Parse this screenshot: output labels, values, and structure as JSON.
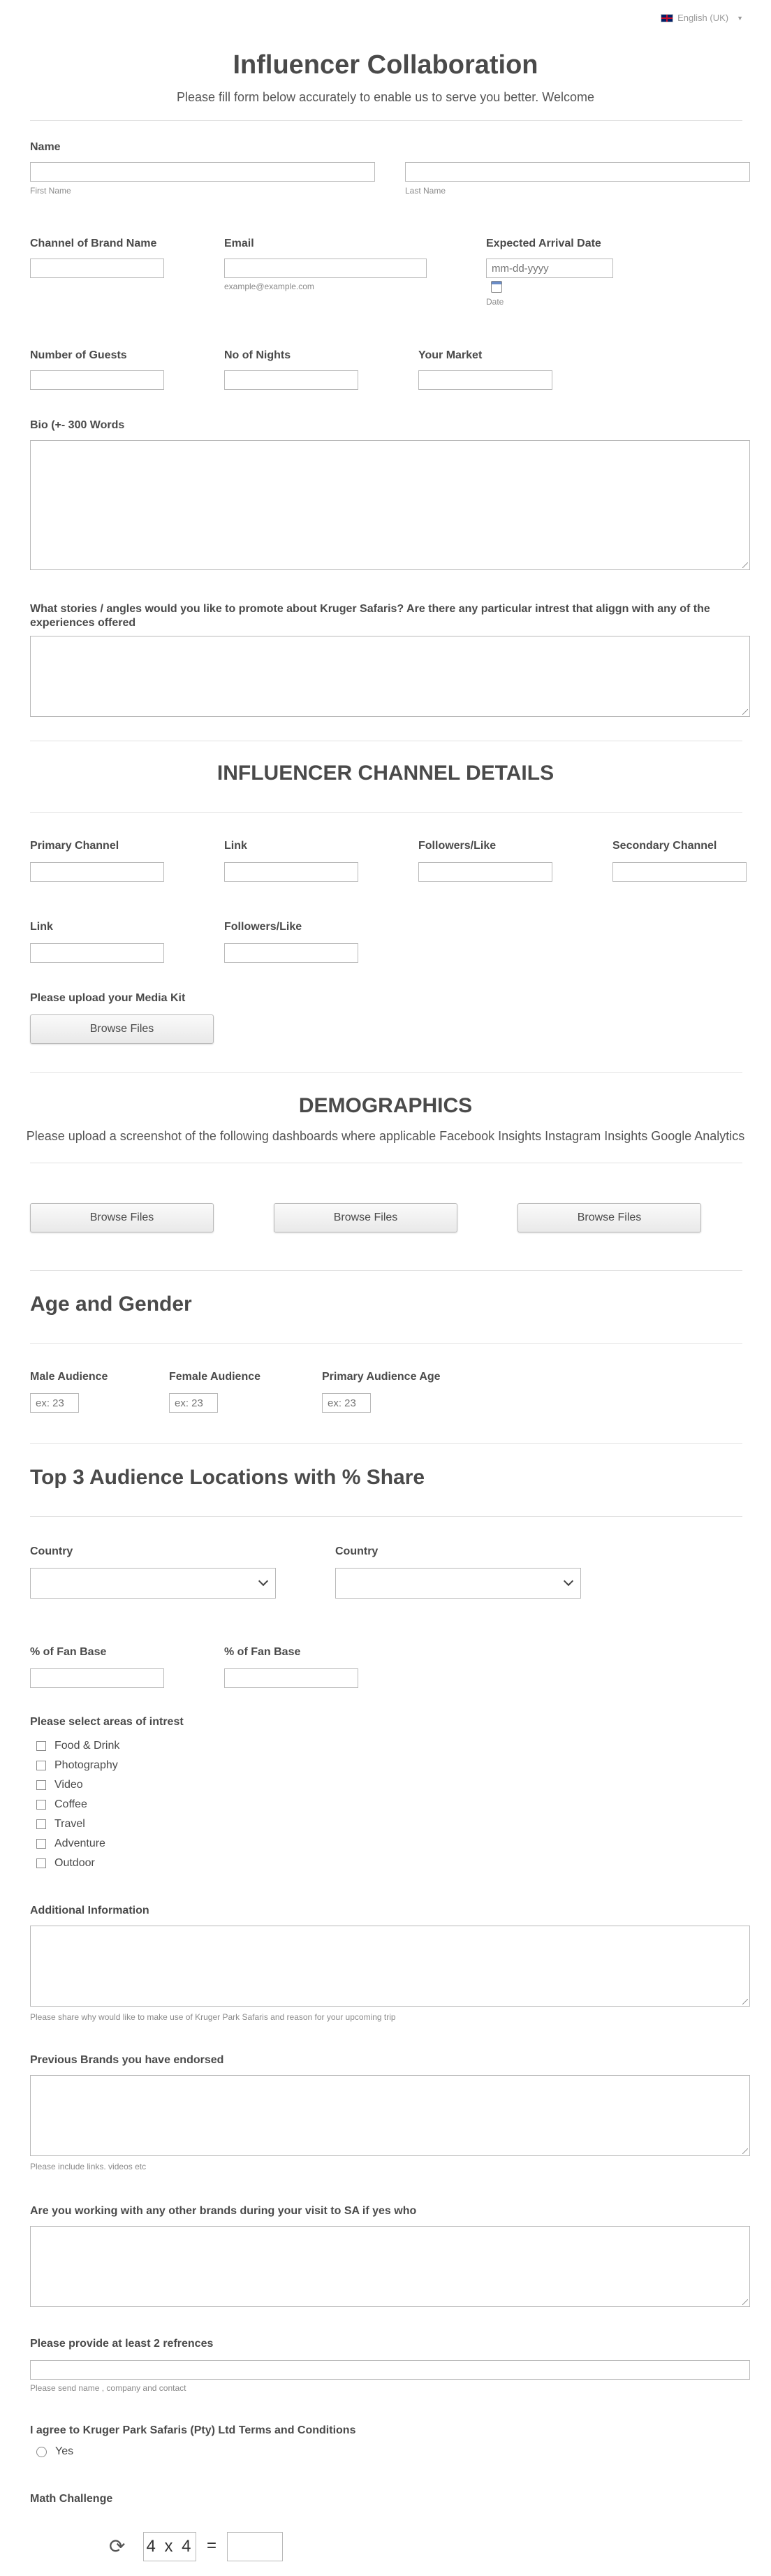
{
  "language": {
    "label": "English (UK)"
  },
  "header": {
    "title": "Influencer Collaboration",
    "subtitle": "Please fill form below accurately to enable us to serve you better. Welcome"
  },
  "fields": {
    "name_label": "Name",
    "first_name_sub": "First Name",
    "last_name_sub": "Last Name",
    "channel_label": "Channel of Brand Name",
    "email_label": "Email",
    "email_sub": "example@example.com",
    "arrival_label": "Expected Arrival Date",
    "arrival_placeholder": "mm-dd-yyyy",
    "arrival_sub": "Date",
    "guests_label": "Number of Guests",
    "nights_label": "No of Nights",
    "market_label": "Your Market",
    "bio_label": "Bio (+- 300 Words",
    "stories_label": "What stories / angles would you like to promote about Kruger Safaris? Are there any particular intrest that aliggn with any of the experiences offered"
  },
  "channel_section": {
    "title": "INFLUENCER CHANNEL DETAILS",
    "primary_label": "Primary Channel",
    "link_label": "Link",
    "followers_label": "Followers/Like",
    "secondary_label": "Secondary Channel",
    "link2_label": "Link",
    "followers2_label": "Followers/Like",
    "media_kit_label": "Please upload your Media Kit",
    "browse_label": "Browse Files"
  },
  "demographics": {
    "title": "DEMOGRAPHICS",
    "desc": "Please upload a screenshot of the following dashboards where applicable Facebook Insights Instagram Insights Google Analytics",
    "browse_label": "Browse Files"
  },
  "age_gender": {
    "title": "Age and Gender",
    "male_label": "Male Audience",
    "female_label": "Female Audience",
    "primary_age_label": "Primary Audience Age",
    "placeholder": "ex: 23"
  },
  "locations": {
    "title": "Top 3 Audience Locations with % Share",
    "country_label": "Country",
    "fan_base_label": "% of Fan Base"
  },
  "interests": {
    "label": "Please select areas of intrest",
    "options": [
      "Food & Drink",
      "Photography",
      "Video",
      "Coffee",
      "Travel",
      "Adventure",
      "Outdoor"
    ]
  },
  "additional": {
    "label": "Additional Information",
    "sub": "Please share why would like to make use of Kruger Park Safaris and reason for your upcoming trip"
  },
  "previous_brands": {
    "label": "Previous Brands you have endorsed",
    "sub": "Please include links. videos etc"
  },
  "other_brands": {
    "label": "Are you working with any other brands during your visit to SA if yes who"
  },
  "references": {
    "label": "Please provide at least 2 refrences",
    "sub": "Please send name , company and contact"
  },
  "terms": {
    "label": "I agree to Kruger Park Safaris (Pty) Ltd Terms and Conditions",
    "option": "Yes"
  },
  "captcha": {
    "label": "Math Challenge",
    "question": "4 x 4",
    "equals": "="
  }
}
